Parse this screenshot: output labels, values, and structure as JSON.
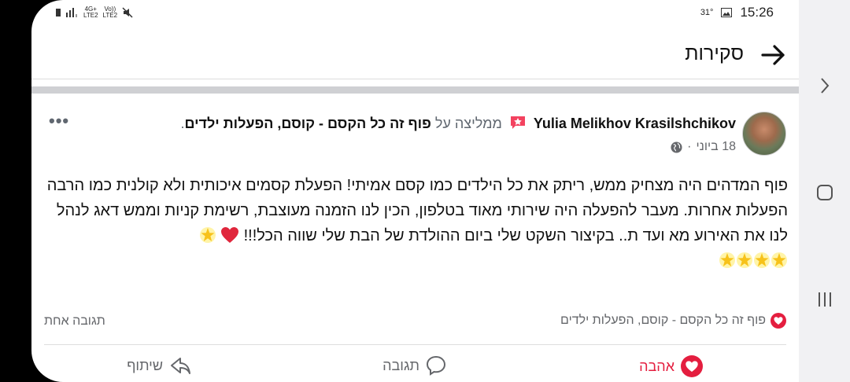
{
  "status_bar": {
    "time": "15:26",
    "temperature": "31°",
    "network_top": "4G+",
    "network_bottom": "LTE2",
    "volte_top": "Vo))",
    "volte_bottom": "LTE2"
  },
  "header": {
    "title": "סקירות"
  },
  "post": {
    "author": "Yulia Melikhov Krasilshchikov",
    "recommends_text": "ממליצה על",
    "page_name": "פוף זה כל הקסם - קוסם, הפעלות ילדים",
    "period": ".",
    "date": "18 ביוני",
    "separator": "·",
    "more": "•••",
    "text_main": "פוף המדהים היה מצחיק ממש, ריתק את כל הילדים כמו קסם אמיתי! הפעלת קסמים איכותית ולא קולנית כמו הרבה הפעלות אחרות. מעבר להפעלה היה שירותי מאוד בטלפון, הכין לנו הזמנה מעוצבת, רשימת קניות וממש דאג לנהל לנו את האירוע מא ועד ת.. בקיצור השקט שלי ביום ההולדת של הבת שלי שווה הכל!!!",
    "reaction_page": "פוף זה כל הקסם - קוסם, הפעלות ילדים",
    "comments_count": "תגובה אחת"
  },
  "actions": {
    "love": "אהבה",
    "comment": "תגובה",
    "share": "שיתוף"
  },
  "colors": {
    "love": "#e41e3f",
    "text": "#111111",
    "muted": "#65676b"
  }
}
